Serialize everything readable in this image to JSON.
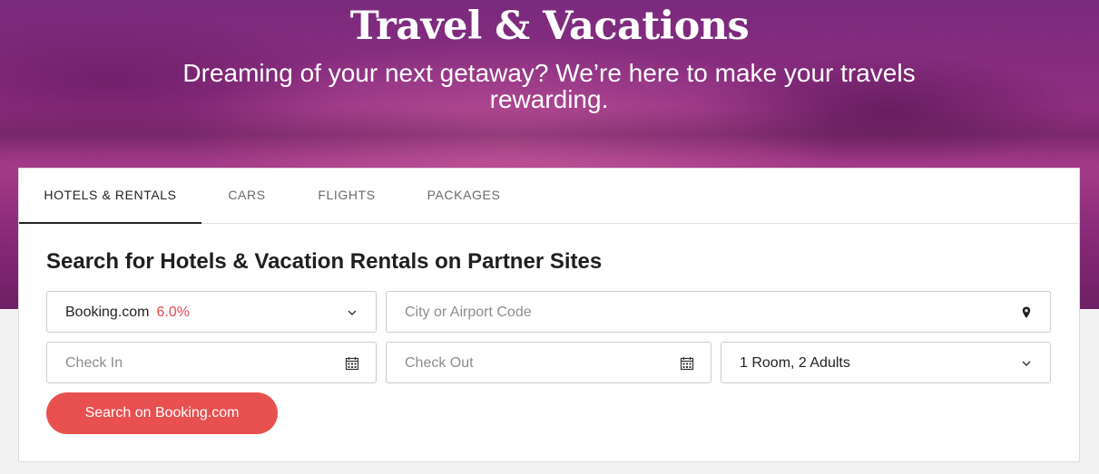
{
  "hero": {
    "title": "Travel & Vacations",
    "subtitle": "Dreaming of your next getaway? We’re here to make your travels rewarding."
  },
  "tabs": [
    {
      "label": "HOTELS & RENTALS",
      "active": true
    },
    {
      "label": "CARS",
      "active": false
    },
    {
      "label": "FLIGHTS",
      "active": false
    },
    {
      "label": "PACKAGES",
      "active": false
    }
  ],
  "search": {
    "heading": "Search for Hotels & Vacation Rentals on Partner Sites",
    "partner": {
      "name": "Booking.com",
      "rate": "6.0%",
      "icon": "chevron-down-icon"
    },
    "destination": {
      "placeholder": "City or Airport Code",
      "icon": "map-pin-icon"
    },
    "check_in": {
      "placeholder": "Check In",
      "icon": "calendar-icon"
    },
    "check_out": {
      "placeholder": "Check Out",
      "icon": "calendar-icon"
    },
    "guests": {
      "value": "1 Room, 2 Adults",
      "icon": "chevron-down-icon"
    },
    "button_label": "Search on Booking.com"
  },
  "colors": {
    "accent": "#e85050",
    "rate_text": "#e1484f",
    "hero_purple": "#8f2e80"
  }
}
